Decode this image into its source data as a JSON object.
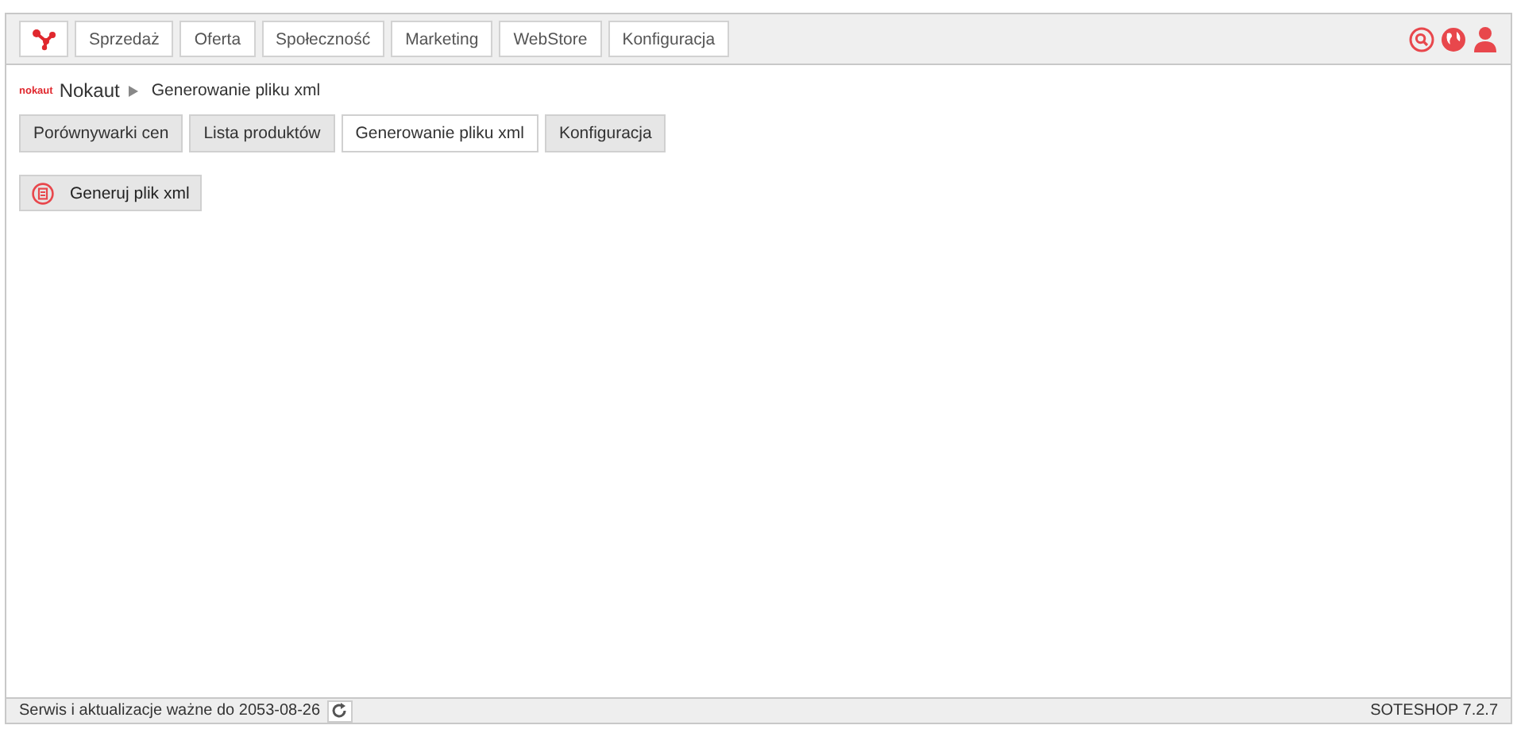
{
  "menu": [
    {
      "label": "Sprzedaż"
    },
    {
      "label": "Oferta"
    },
    {
      "label": "Społeczność"
    },
    {
      "label": "Marketing"
    },
    {
      "label": "WebStore"
    },
    {
      "label": "Konfiguracja"
    }
  ],
  "breadcrumb": {
    "logo": "nokaut",
    "module": "Nokaut",
    "page": "Generowanie pliku xml"
  },
  "tabs": [
    {
      "label": "Porównywarki cen",
      "selected": false
    },
    {
      "label": "Lista produktów",
      "selected": false
    },
    {
      "label": "Generowanie pliku xml",
      "selected": true
    },
    {
      "label": "Konfiguracja",
      "selected": false
    }
  ],
  "action_button": {
    "label": "Generuj plik xml"
  },
  "status_bar": {
    "license": "Serwis i aktualizacje ważne do 2053-08-26",
    "version": "SOTESHOP 7.2.7"
  }
}
